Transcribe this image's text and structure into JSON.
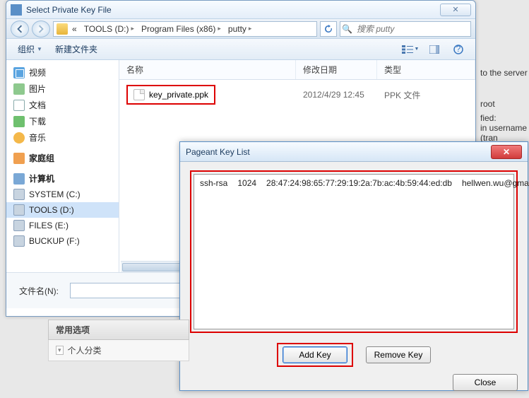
{
  "file_dialog": {
    "title": "Select Private Key File",
    "close_glyph": "✕",
    "breadcrumb": {
      "root_glyph": "«",
      "items": [
        "TOOLS (D:)",
        "Program Files (x86)",
        "putty"
      ]
    },
    "search": {
      "placeholder": "搜索 putty"
    },
    "toolbar": {
      "organize": "组织",
      "new_folder": "新建文件夹"
    },
    "tree": {
      "items": [
        {
          "label": "视频",
          "icon": "video"
        },
        {
          "label": "图片",
          "icon": "pic"
        },
        {
          "label": "文档",
          "icon": "doc"
        },
        {
          "label": "下载",
          "icon": "down"
        },
        {
          "label": "音乐",
          "icon": "music"
        }
      ],
      "group_home": "家庭组",
      "group_computer": "计算机",
      "drives": [
        "SYSTEM (C:)",
        "TOOLS (D:)",
        "FILES (E:)",
        "BUCKUP (F:)"
      ],
      "selected_drive": "TOOLS (D:)"
    },
    "list": {
      "headers": {
        "name": "名称",
        "date": "修改日期",
        "type": "类型"
      },
      "rows": [
        {
          "name": "key_private.ppk",
          "date": "2012/4/29 12:45",
          "type": "PPK 文件"
        }
      ]
    },
    "filename_label": "文件名(N):"
  },
  "pageant": {
    "title": "Pageant Key List",
    "close_glyph": "✕",
    "keys": [
      {
        "type": "ssh-rsa",
        "bits": "1024",
        "fingerprint": "28:47:24:98:65:77:29:19:2a:7b:ac:4b:59:44:ed:db",
        "comment": "hellwen.wu@gmail.com"
      }
    ],
    "buttons": {
      "add": "Add Key",
      "remove": "Remove Key",
      "close": "Close"
    }
  },
  "bottom_panel": {
    "header": "常用选项",
    "item": "个人分类"
  },
  "bg": {
    "t1": "to the server",
    "t2": "root",
    "t3": "fied:",
    "t4": "in username (tran"
  }
}
